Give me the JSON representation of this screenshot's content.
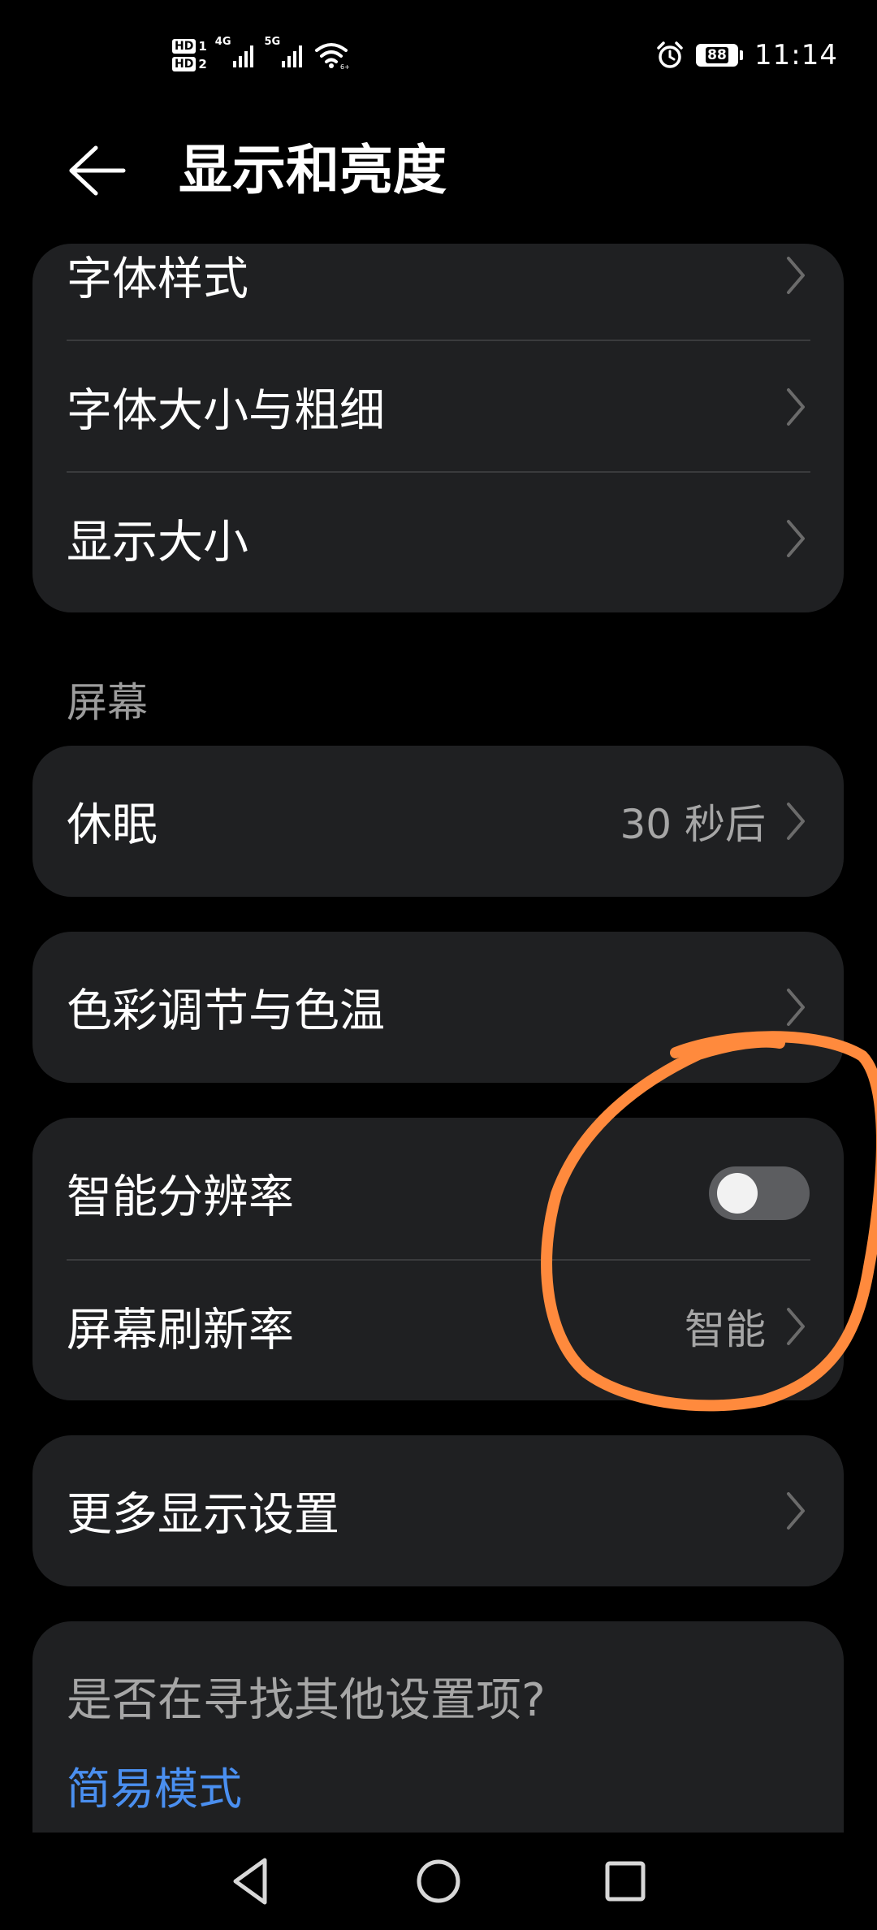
{
  "status_bar": {
    "sim1_label": "HD",
    "sim1_num": "1",
    "sim2_label": "HD",
    "sim2_num": "2",
    "sim1_network": "4G",
    "sim2_network": "5G",
    "battery_level": "88",
    "time": "11:14",
    "icons": [
      "signal-icon",
      "wifi-icon",
      "alarm-icon",
      "battery-icon"
    ]
  },
  "header": {
    "title": "显示和亮度",
    "back_icon": "arrow-left-icon"
  },
  "font_card": {
    "items": [
      {
        "label": "字体样式"
      },
      {
        "label": "字体大小与粗细"
      },
      {
        "label": "显示大小"
      }
    ]
  },
  "screen_section": {
    "label": "屏幕"
  },
  "sleep": {
    "label": "休眠",
    "value": "30 秒后"
  },
  "color": {
    "label": "色彩调节与色温"
  },
  "resolution_card": {
    "smart_resolution_label": "智能分辨率",
    "smart_resolution_on": false,
    "refresh_rate_label": "屏幕刷新率",
    "refresh_rate_value": "智能"
  },
  "more_display": {
    "label": "更多显示设置"
  },
  "search_card": {
    "question": "是否在寻找其他设置项?",
    "link": "简易模式"
  },
  "colors": {
    "background": "#000000",
    "card": "#1f2022",
    "link": "#4a8ff0",
    "annotation": "#ff8a3d"
  }
}
